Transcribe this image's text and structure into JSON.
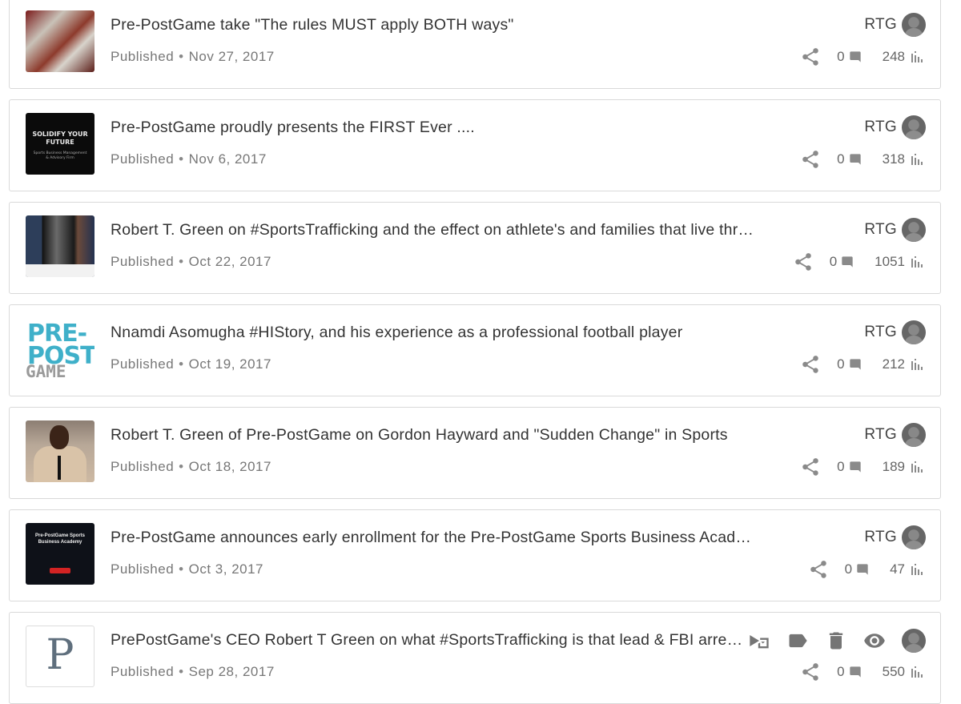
{
  "posts": [
    {
      "title": "Pre-PostGame take \"The rules MUST apply BOTH ways\"",
      "status": "Published",
      "date": "Nov 27, 2017",
      "author": "RTG",
      "comments": "0",
      "views": "248",
      "thumb": "football"
    },
    {
      "title": "Pre-PostGame proudly presents the FIRST Ever ....",
      "status": "Published",
      "date": "Nov 6, 2017",
      "author": "RTG",
      "comments": "0",
      "views": "318",
      "thumb": "solidify",
      "thumb_text": "SOLIDIFY YOUR FUTURE",
      "thumb_subtext": "Sports Business Management & Advisory Firm"
    },
    {
      "title": "Robert T. Green on #SportsTrafficking and the effect on athlete's and families that live thr…",
      "status": "Published",
      "date": "Oct 22, 2017",
      "author": "RTG",
      "comments": "0",
      "views": "1051",
      "thumb": "collage"
    },
    {
      "title": "Nnamdi Asomugha #HIStory, and his experience as a professional football player",
      "status": "Published",
      "date": "Oct 19, 2017",
      "author": "RTG",
      "comments": "0",
      "views": "212",
      "thumb": "logo",
      "logo_lines": [
        "PRE-",
        "POST",
        "GAME"
      ]
    },
    {
      "title": "Robert T. Green of Pre-PostGame on Gordon Hayward and \"Sudden Change\" in Sports",
      "status": "Published",
      "date": "Oct 18, 2017",
      "author": "RTG",
      "comments": "0",
      "views": "189",
      "thumb": "speaker"
    },
    {
      "title": "Pre-PostGame announces early enrollment for the Pre-PostGame Sports Business Acade…",
      "status": "Published",
      "date": "Oct 3, 2017",
      "author": "RTG",
      "comments": "0",
      "views": "47",
      "thumb": "academy",
      "thumb_text": "Pre-PostGame Sports Business Academy"
    },
    {
      "title": "PrePostGame's CEO Robert T Green on what #SportsTrafficking is that lead & FBI arrestin…",
      "status": "Published",
      "date": "Sep 28, 2017",
      "author": "",
      "comments": "0",
      "views": "550",
      "thumb": "letter",
      "thumb_letter": "P",
      "hovered": true,
      "hover_actions": [
        "move-to-icon",
        "label-icon",
        "delete-icon",
        "visibility-icon"
      ]
    }
  ],
  "colors": {
    "icon": "#8a8a8a",
    "icon_dark": "#757575",
    "accent_logo": "#3fb0c9"
  }
}
